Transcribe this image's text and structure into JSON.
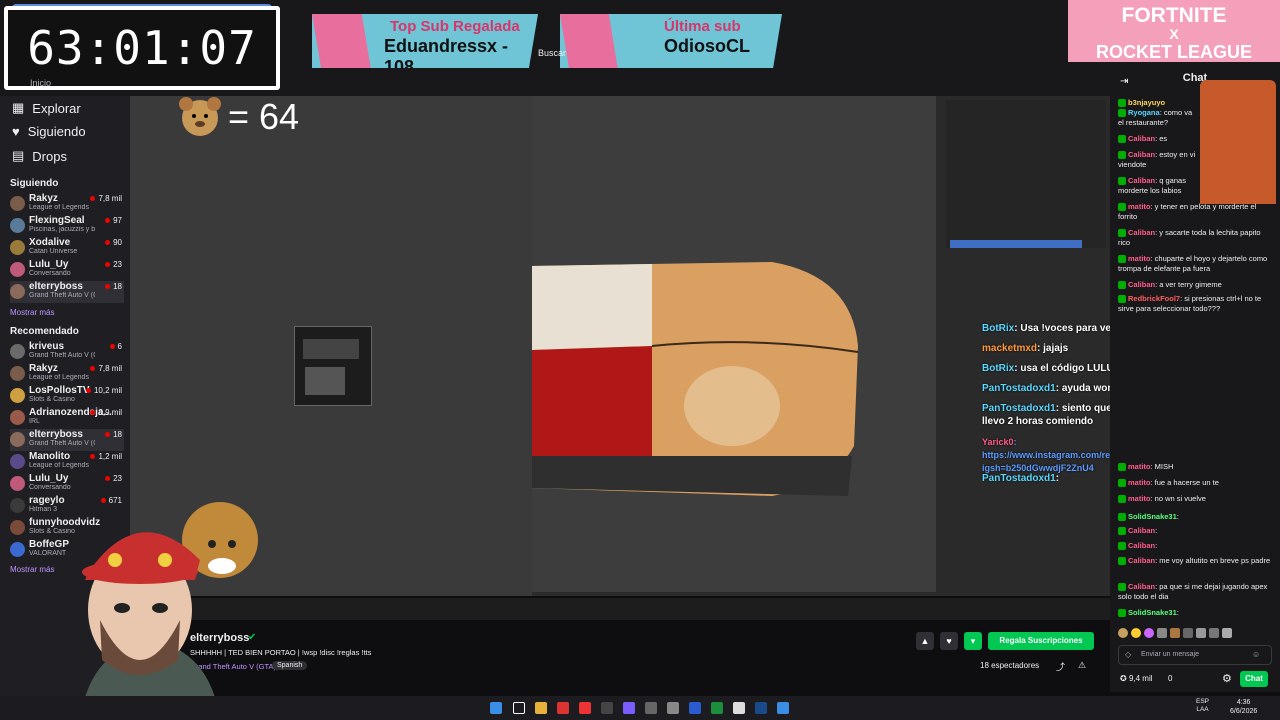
{
  "timer": "63:01:07",
  "banner_left": {
    "title": "Top Sub Regalada",
    "value": "Eduandressx - 108"
  },
  "banner_right": {
    "title": "Última sub",
    "value": "OdiosoCL"
  },
  "promo": {
    "line1": "FORTNITE",
    "line2": "X",
    "line3": "ROCKET LEAGUE"
  },
  "browser": {
    "search": "Buscar",
    "home": "Inicio"
  },
  "bear_counter": "= 64",
  "sidebar": {
    "nav": [
      {
        "label": "Explorar"
      },
      {
        "label": "Siguiendo"
      },
      {
        "label": "Drops"
      }
    ],
    "following_header": "Siguiendo",
    "following": [
      {
        "name": "Rakyz",
        "game": "League of Legends",
        "viewers": "7,8 mil"
      },
      {
        "name": "FlexingSeal",
        "game": "Piscinas, jacuzzis y biki...",
        "viewers": "97"
      },
      {
        "name": "Xodalive",
        "game": "Catan Universe",
        "viewers": "90"
      },
      {
        "name": "Lulu_Uy",
        "game": "Conversando",
        "viewers": "23"
      },
      {
        "name": "elterryboss",
        "game": "Grand Theft Auto V (GTA)",
        "viewers": "18"
      }
    ],
    "show_more_1": "Mostrar más",
    "recommended_header": "Recomendado",
    "recommended": [
      {
        "name": "kriveus",
        "game": "Grand Theft Auto V (GTA)",
        "viewers": "6"
      },
      {
        "name": "Rakyz",
        "game": "League of Legends",
        "viewers": "7,8 mil"
      },
      {
        "name": "LosPollosTV",
        "game": "Slots & Casino",
        "viewers": "10,2 mil"
      },
      {
        "name": "Adrianozendeja...",
        "game": "IRL",
        "viewers": "8,9 mil"
      },
      {
        "name": "elterryboss",
        "game": "Grand Theft Auto V (GTA)",
        "viewers": "18"
      },
      {
        "name": "Manolito",
        "game": "League of Legends",
        "viewers": "1,2 mil"
      },
      {
        "name": "Lulu_Uy",
        "game": "Conversando",
        "viewers": "23"
      },
      {
        "name": "rageylo",
        "game": "Hitman 3",
        "viewers": "671"
      },
      {
        "name": "funnyhoodvidz",
        "game": "Slots & Casino",
        "viewers": ""
      },
      {
        "name": "BoffeGP",
        "game": "VALORANT",
        "viewers": ""
      }
    ],
    "show_more_2": "Mostrar más"
  },
  "overlay_chat": [
    {
      "user": "BotRix",
      "text": ": Usa !voces para ver todos los comandos del TTS",
      "color": "#5bd7ff"
    },
    {
      "user": "macketmxd",
      "text": ": jajajs",
      "color": "#ff9a3c"
    },
    {
      "user": "BotRix",
      "text": ": usa el código LULUI en todo EPIC y FORTNITE",
      "color": "#5bd7ff"
    },
    {
      "user": "PanTostadoxd1",
      "text": ": ayuda won",
      "color": "#5bd7ff"
    },
    {
      "user": "PanTostadoxd1",
      "text": ": siento que llevo 2 horas comiendo",
      "color": "#5bd7ff"
    },
    {
      "user": "Yarick0",
      "text": ": https://www.instagram.com/reel/DVMmy7akQUI/?igsh=b250dGwwdjF2ZnU4",
      "color": "#ff5c8a"
    },
    {
      "user": "PanTostadoxd1",
      "text": ":",
      "color": "#5bd7ff"
    }
  ],
  "chat": {
    "title": "Chat",
    "messages": [
      {
        "user": "b3njayuyo",
        "text": ""
      },
      {
        "user": "Ryogana",
        "text": ": como va el restaurante?"
      },
      {
        "user": "Caliban",
        "text": ": es"
      },
      {
        "user": "Caliban",
        "text": ": estoy en vi viendote"
      },
      {
        "user": "Caliban",
        "text": ": q ganas morderte los labios"
      },
      {
        "user": "matito",
        "text": ": y tener en pelota y morderte el forrito"
      },
      {
        "user": "Caliban",
        "text": ": y sacarte toda la lechita papito rico"
      },
      {
        "user": "matito",
        "text": ": chuparte el hoyo y dejartelo como trompa de elefante pa fuera"
      },
      {
        "user": "Caliban",
        "text": ": a ver terry gimeme"
      },
      {
        "user": "RedbrickFool7",
        "text": ": si presionas ctrl+l no te sirve para seleccionar todo???"
      },
      {
        "user": "matito",
        "text": ": MISH"
      },
      {
        "user": "matito",
        "text": ": fue a hacerse un te"
      },
      {
        "user": "matito",
        "text": ": no wn si vuelve"
      },
      {
        "user": "SolidSnake31",
        "text": ":"
      },
      {
        "user": "Caliban",
        "text": ":"
      },
      {
        "user": "Caliban",
        "text": ":"
      },
      {
        "user": "Caliban",
        "text": ": me voy altutito en breve ps padre"
      },
      {
        "user": "Caliban",
        "text": ": pa que si me dejai jugando apex solo todo el dia"
      },
      {
        "user": "SolidSnake31",
        "text": ":"
      }
    ],
    "input_placeholder": "Enviar un mensaje",
    "points": "9,4 mil",
    "zero": "0",
    "send_label": "Chat"
  },
  "stream": {
    "streamer": "elterryboss",
    "title": "SHHHHH | TED BIEN PORTAO | !wsp !disc !reglas !tts",
    "game": "Grand Theft Auto V (GTA)",
    "language": "Spanish",
    "viewers": "18 espectadores",
    "gift_label": "Regala Suscripciones"
  },
  "windows": {
    "lang": "ESP",
    "lang2": "LAA",
    "time": "4:36",
    "date": "6/6/2026"
  }
}
